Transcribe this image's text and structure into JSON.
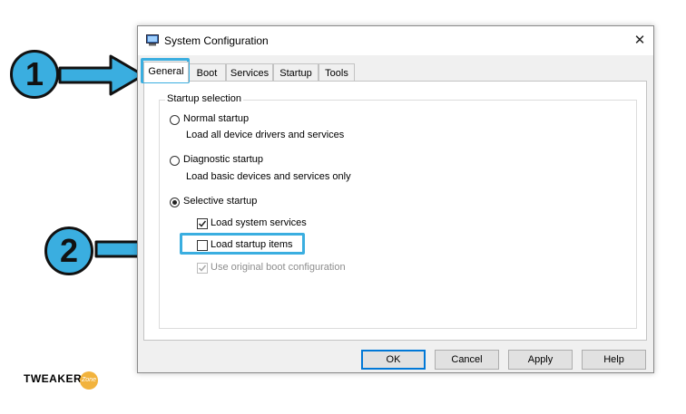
{
  "window": {
    "title": "System Configuration",
    "close_icon": "close-icon"
  },
  "tabs": [
    {
      "label": "General",
      "active": true
    },
    {
      "label": "Boot"
    },
    {
      "label": "Services"
    },
    {
      "label": "Startup"
    },
    {
      "label": "Tools"
    }
  ],
  "startup_selection": {
    "legend": "Startup selection",
    "normal": {
      "label": "Normal startup",
      "desc": "Load all device drivers and services",
      "selected": false
    },
    "diagnostic": {
      "label": "Diagnostic startup",
      "desc": "Load basic devices and services only",
      "selected": false
    },
    "selective": {
      "label": "Selective startup",
      "selected": true,
      "options": [
        {
          "label": "Load system services",
          "checked": true
        },
        {
          "label": "Load startup items",
          "checked": false
        },
        {
          "label": "Use original boot configuration",
          "checked": true,
          "disabled": true
        }
      ]
    }
  },
  "buttons": {
    "ok": "OK",
    "cancel": "Cancel",
    "apply": "Apply",
    "help": "Help"
  },
  "annotations": {
    "step1": "1",
    "step2": "2",
    "highlight_color": "#3aaee0"
  },
  "branding": {
    "name": "TWEAKER",
    "zone": "Zone"
  }
}
